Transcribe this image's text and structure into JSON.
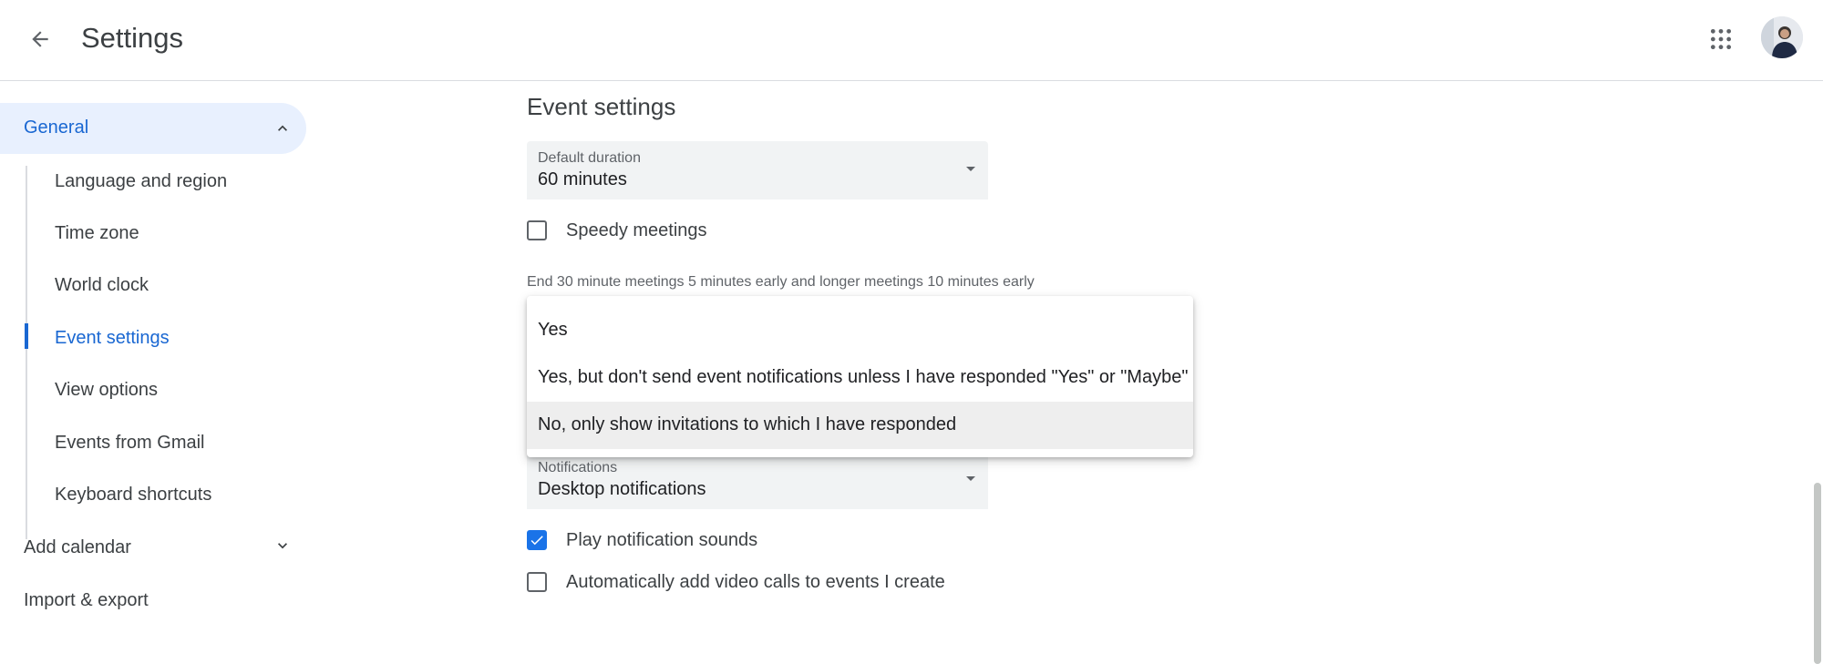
{
  "header": {
    "title": "Settings",
    "back_icon": "arrow-back-icon",
    "apps_icon": "apps-grid-icon",
    "avatar_icon": "user-avatar"
  },
  "sidebar": {
    "general": {
      "label": "General",
      "icon": "chevron-up-icon",
      "expanded": true
    },
    "sub_items": [
      {
        "label": "Language and region"
      },
      {
        "label": "Time zone"
      },
      {
        "label": "World clock"
      },
      {
        "label": "Event settings",
        "active": true
      },
      {
        "label": "View options"
      },
      {
        "label": "Events from Gmail"
      },
      {
        "label": "Keyboard shortcuts"
      }
    ],
    "add_calendar": {
      "label": "Add calendar",
      "icon": "chevron-down-icon"
    },
    "import_export": {
      "label": "Import & export"
    }
  },
  "main": {
    "section_title": "Event settings",
    "default_duration": {
      "label": "Default duration",
      "value": "60 minutes"
    },
    "speedy_meetings": {
      "label": "Speedy meetings",
      "checked": false,
      "help": "End 30 minute meetings 5 minutes early and longer meetings 10 minutes early"
    },
    "dropdown_options": [
      {
        "label": "Yes"
      },
      {
        "label": "Yes, but don't send event notifications unless I have responded \"Yes\" or \"Maybe\""
      },
      {
        "label": "No, only show invitations to which I have responded",
        "highlighted": true
      }
    ],
    "notifications": {
      "label": "Notifications",
      "value": "Desktop notifications"
    },
    "play_sounds": {
      "label": "Play notification sounds",
      "checked": true
    },
    "video_calls": {
      "label": "Automatically add video calls to events I create",
      "checked": false
    }
  },
  "colors": {
    "accent": "#1a73e8",
    "active_text": "#1967d2",
    "active_bg": "#e8f0fe"
  }
}
